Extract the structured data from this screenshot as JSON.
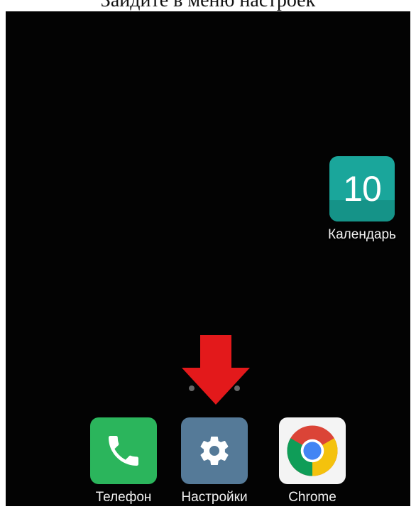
{
  "caption": {
    "text": "Зайдите в меню настроек"
  },
  "home_screen": {
    "calendar": {
      "label": "Календарь",
      "day": "10",
      "icon": "calendar-icon",
      "color": "#1aa69b"
    },
    "page_indicator": {
      "pages": 3,
      "active": 2
    },
    "dock": [
      {
        "label": "Телефон",
        "icon": "phone-icon",
        "color": "#2bb55c"
      },
      {
        "label": "Настройки",
        "icon": "gear-icon",
        "color": "#557a98"
      },
      {
        "label": "Chrome",
        "icon": "chrome-icon",
        "color": "#f4f4f4"
      }
    ]
  },
  "annotation": {
    "icon": "red-arrow-down-icon",
    "color": "#e3191b"
  }
}
